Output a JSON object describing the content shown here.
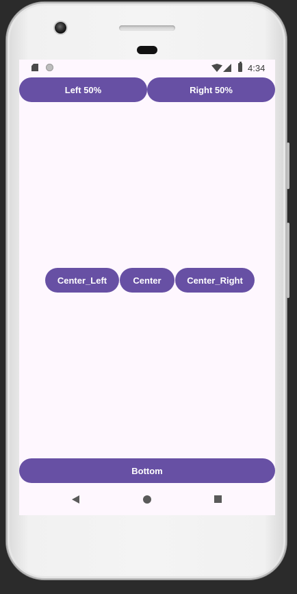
{
  "status_bar": {
    "time": "4:34",
    "icons": [
      "sd-card-icon",
      "circle-notification-icon",
      "wifi-icon",
      "cell-signal-icon",
      "battery-icon"
    ]
  },
  "buttons": {
    "left_half": "Left 50%",
    "right_half": "Right 50%",
    "center_left": "Center_Left",
    "center": "Center",
    "center_right": "Center_Right",
    "bottom": "Bottom"
  },
  "navigation": {
    "icons": [
      "back-icon",
      "home-icon",
      "recents-icon"
    ]
  },
  "colors": {
    "button_bg": "#6750a4",
    "button_text": "#ffffff",
    "screen_bg": "#fef7fe"
  }
}
